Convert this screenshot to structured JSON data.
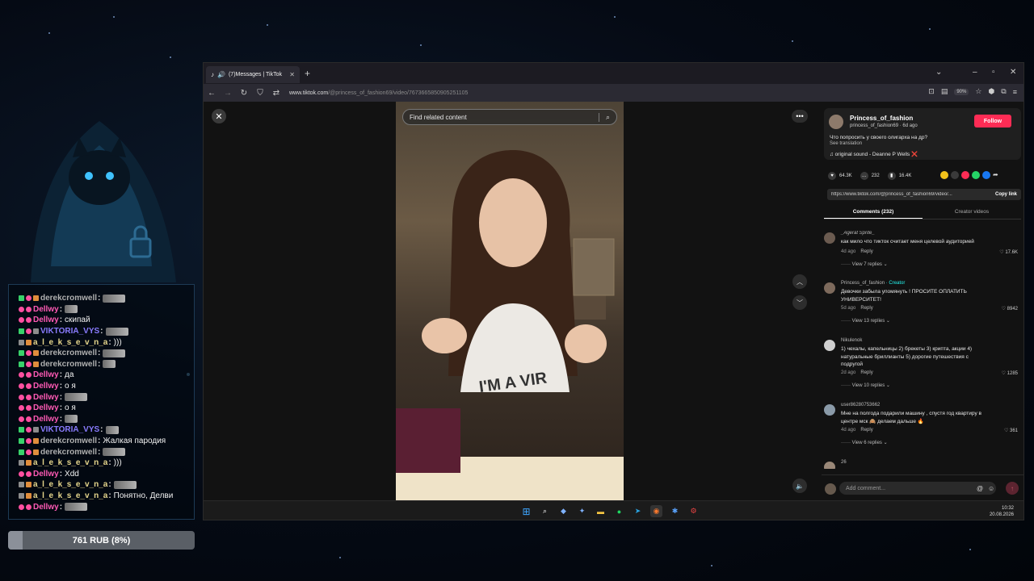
{
  "browser": {
    "tab_title": "(7)Messages | TikTok",
    "url_host": "www.tiktok.com",
    "url_path": "/@princess_of_fashion69/video/7673665850905251105",
    "zoom": "90%"
  },
  "video": {
    "search_placeholder": "Find related content"
  },
  "author": {
    "name": "Princess_of_fashion",
    "handle_line": "princess_of_fashion69 · 6d ago",
    "follow_label": "Follow",
    "caption": "Что попросить у своего олигарха на др?",
    "see_translation": "See translation",
    "sound": "♫  original sound - Deanne P Wells ❌"
  },
  "stats": {
    "likes": "64.3K",
    "comments": "232",
    "saves": "16.4K"
  },
  "link": {
    "url": "https://www.tiktok.com/@princess_of_fashion69/video/...",
    "copy_label": "Copy link"
  },
  "tabs": {
    "comments": "Comments (232)",
    "creator": "Creator videos"
  },
  "comments": [
    {
      "user": "_Agerat Sprite_",
      "text": "как мило что тикток считает меня целевой аудиторией",
      "date": "4d ago",
      "reply": "Reply",
      "likes": "17.6K",
      "replies": "View 7 replies ⌄"
    },
    {
      "user": "Princess_of_fashion",
      "creator": " · Creator",
      "text": "Девочки забыла упомянуть ! ПРОСИТЕ ОПЛАТИТЬ УНИВЕРСИТЕТ!",
      "date": "5d ago",
      "reply": "Reply",
      "likes": "8942",
      "replies": "View 13 replies ⌄"
    },
    {
      "user": "Nikulenok",
      "text": "1) чехалы, капельницы 2) брекеты 3) крипта, акции 4) натуральные бриллианты 5) дорогие путешествия с подругой",
      "date": "2d ago",
      "reply": "Reply",
      "likes": "1285",
      "replies": "View 10 replies ⌄"
    },
    {
      "user": "user86280753662",
      "text": "Мне на полгода подарили машину , спустя год квартиру в центре мск 🙈 делаем дальше 🔥",
      "date": "4d ago",
      "reply": "Reply",
      "likes": "361",
      "replies": "View 6 replies ⌄"
    },
    {
      "user": "26",
      "text": "",
      "date": "",
      "reply": "",
      "likes": "",
      "replies": ""
    }
  ],
  "comment_bar": {
    "placeholder": "Add comment..."
  },
  "taskbar": {
    "time": "10:32",
    "date": "20.08.2026"
  },
  "chat": [
    {
      "user": "derekcromwell",
      "user_color": "#b0b0b0",
      "badges": [
        "green",
        "pink",
        "orange"
      ],
      "msg": "",
      "emote": "wide"
    },
    {
      "user": "Dellwy",
      "user_color": "#ff5ab5",
      "badges": [
        "pink",
        "pink"
      ],
      "msg": "",
      "emote": "small"
    },
    {
      "user": "Dellwy",
      "user_color": "#ff5ab5",
      "badges": [
        "pink",
        "pink"
      ],
      "msg": "скипай",
      "emote": ""
    },
    {
      "user": "VIKTORIA_VYS",
      "user_color": "#8a7cff",
      "badges": [
        "green",
        "pink",
        "gray"
      ],
      "msg": "",
      "emote": "wide"
    },
    {
      "user": "a_l_e_k_s_e_v_n_a",
      "user_color": "#e6d68c",
      "badges": [
        "gray",
        "orange"
      ],
      "msg": ")))",
      "emote": ""
    },
    {
      "user": "derekcromwell",
      "user_color": "#b0b0b0",
      "badges": [
        "green",
        "pink",
        "orange"
      ],
      "msg": "",
      "emote": "wide"
    },
    {
      "user": "derekcromwell",
      "user_color": "#b0b0b0",
      "badges": [
        "green",
        "pink",
        "orange"
      ],
      "msg": "",
      "emote": "small"
    },
    {
      "user": "Dellwy",
      "user_color": "#ff5ab5",
      "badges": [
        "pink",
        "pink"
      ],
      "msg": "да",
      "emote": ""
    },
    {
      "user": "Dellwy",
      "user_color": "#ff5ab5",
      "badges": [
        "pink",
        "pink"
      ],
      "msg": "о я",
      "emote": ""
    },
    {
      "user": "Dellwy",
      "user_color": "#ff5ab5",
      "badges": [
        "pink",
        "pink"
      ],
      "msg": "",
      "emote": "wide"
    },
    {
      "user": "Dellwy",
      "user_color": "#ff5ab5",
      "badges": [
        "pink",
        "pink"
      ],
      "msg": "о я",
      "emote": ""
    },
    {
      "user": "Dellwy",
      "user_color": "#ff5ab5",
      "badges": [
        "pink",
        "pink"
      ],
      "msg": "",
      "emote": "small"
    },
    {
      "user": "VIKTORIA_VYS",
      "user_color": "#8a7cff",
      "badges": [
        "green",
        "pink",
        "gray"
      ],
      "msg": "",
      "emote": "small"
    },
    {
      "user": "derekcromwell",
      "user_color": "#b0b0b0",
      "badges": [
        "green",
        "pink",
        "orange"
      ],
      "msg": "Жалкая пародия",
      "emote": ""
    },
    {
      "user": "derekcromwell",
      "user_color": "#b0b0b0",
      "badges": [
        "green",
        "pink",
        "orange"
      ],
      "msg": "",
      "emote": "wide"
    },
    {
      "user": "a_l_e_k_s_e_v_n_a",
      "user_color": "#e6d68c",
      "badges": [
        "gray",
        "orange"
      ],
      "msg": ")))",
      "emote": ""
    },
    {
      "user": "Dellwy",
      "user_color": "#ff5ab5",
      "badges": [
        "pink",
        "pink"
      ],
      "msg": "Xdd",
      "emote": ""
    },
    {
      "user": "a_l_e_k_s_e_v_n_a",
      "user_color": "#e6d68c",
      "badges": [
        "gray",
        "orange"
      ],
      "msg": "",
      "emote": "wide"
    },
    {
      "user": "a_l_e_k_s_e_v_n_a",
      "user_color": "#e6d68c",
      "badges": [
        "gray",
        "orange"
      ],
      "msg": "Понятно, Делви",
      "emote": ""
    },
    {
      "user": "Dellwy",
      "user_color": "#ff5ab5",
      "badges": [
        "pink",
        "pink"
      ],
      "msg": "",
      "emote": "wide"
    }
  ],
  "goal": {
    "label": "761 RUB (8%)",
    "fraction": 0.08
  }
}
